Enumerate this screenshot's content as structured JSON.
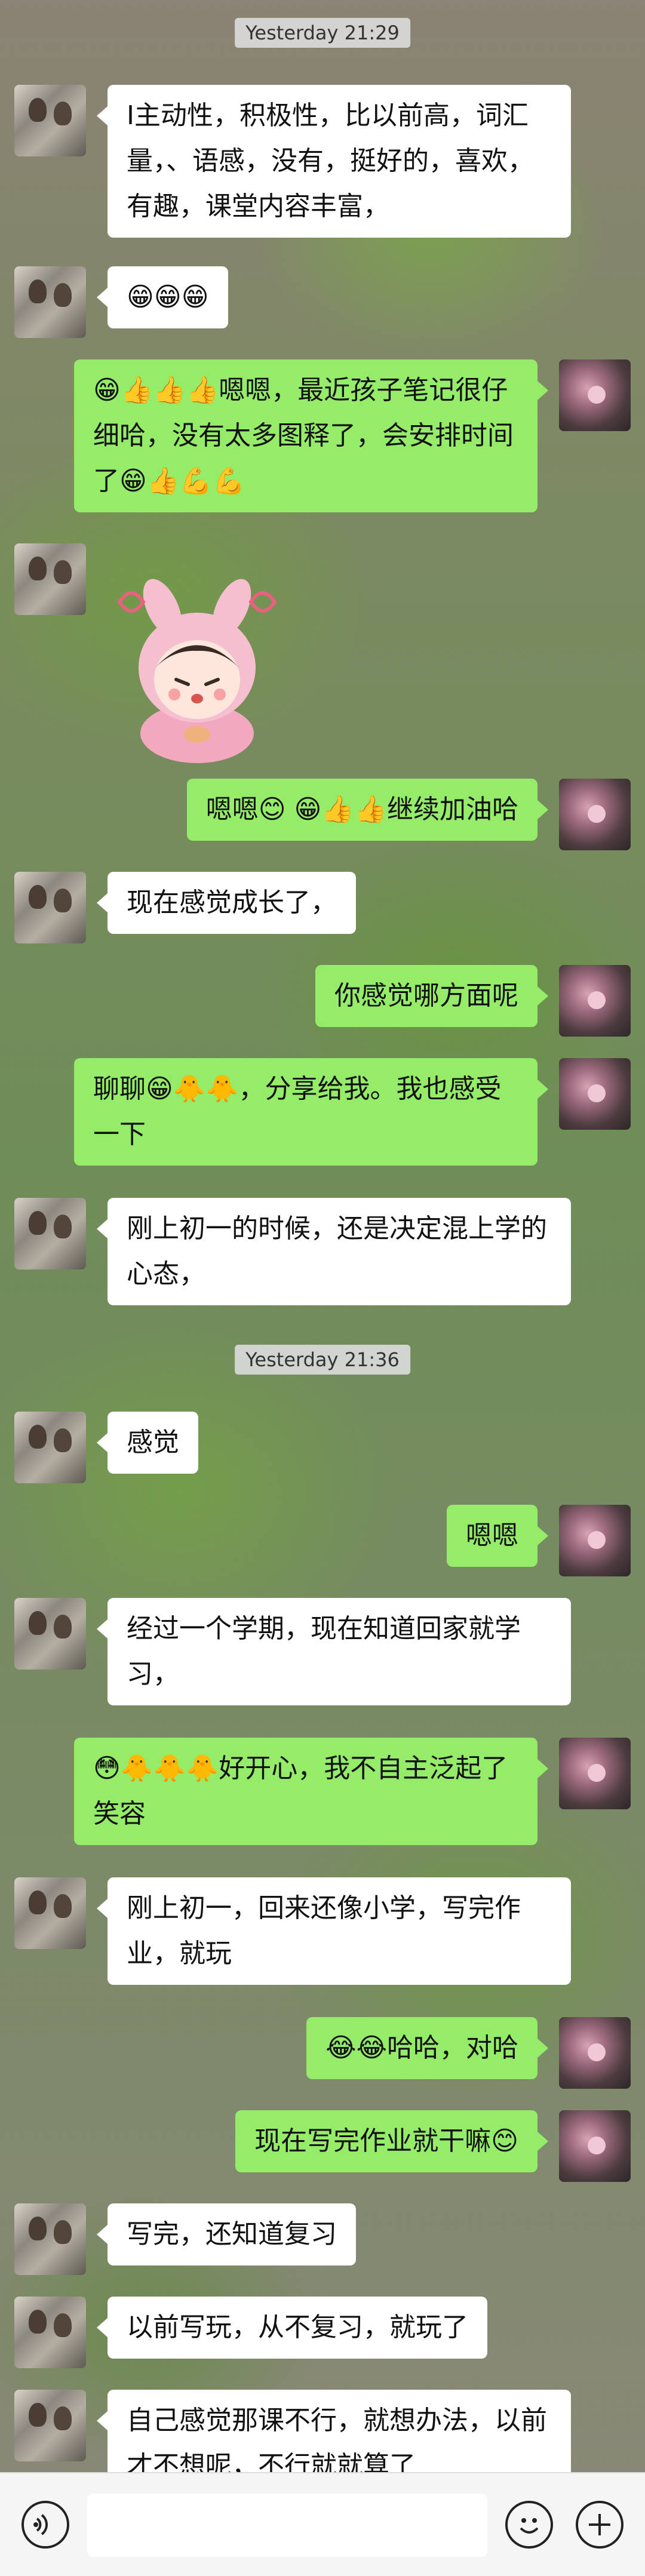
{
  "timestamps": [
    "Yesterday 21:29",
    "Yesterday 21:36"
  ],
  "messages": [
    {
      "from": "peer",
      "text": "I主动性，积极性，比以前高，词汇量，、语感，没有，挺好的，喜欢，有趣，课堂内容丰富，"
    },
    {
      "from": "peer",
      "text": "😁😁😁"
    },
    {
      "from": "self",
      "text": "😁👍👍👍嗯嗯，最近孩子笔记很仔细哈，没有太多图释了，会安排时间了😁👍💪💪"
    },
    {
      "from": "peer",
      "text": "",
      "sticker": "girl-blowing-kiss-sticker"
    },
    {
      "from": "self",
      "text": "嗯嗯😊 😁👍👍继续加油哈"
    },
    {
      "from": "peer",
      "text": "现在感觉成长了，"
    },
    {
      "from": "self",
      "text": "你感觉哪方面呢"
    },
    {
      "from": "self",
      "text": "聊聊😁🐥🐥，分享给我。我也感受一下"
    },
    {
      "from": "peer",
      "text": "刚上初一的时候，还是决定混上学的心态，"
    },
    {
      "from": "peer",
      "text": "感觉"
    },
    {
      "from": "self",
      "text": "嗯嗯"
    },
    {
      "from": "peer",
      "text": "经过一个学期，现在知道回家就学习，"
    },
    {
      "from": "self",
      "text": "😳🐥🐥🐥好开心，我不自主泛起了笑容"
    },
    {
      "from": "peer",
      "text": "刚上初一，回来还像小学，写完作业，就玩"
    },
    {
      "from": "self",
      "text": "😂😂哈哈，对哈"
    },
    {
      "from": "self",
      "text": "现在写完作业就干嘛😊"
    },
    {
      "from": "peer",
      "text": "写完，还知道复习"
    },
    {
      "from": "peer",
      "text": "以前写玩，从不复习，就玩了"
    },
    {
      "from": "peer",
      "text": "自己感觉那课不行，就想办法，以前才不想呢，不行就就算了"
    }
  ],
  "input_bar": {
    "placeholder": ""
  },
  "icons": {
    "voice": "voice-icon",
    "emoji": "emoji-icon",
    "more": "plus-icon"
  },
  "colors": {
    "incoming": "#ffffff",
    "outgoing": "#95ec69",
    "bar": "#f5f5f5"
  }
}
